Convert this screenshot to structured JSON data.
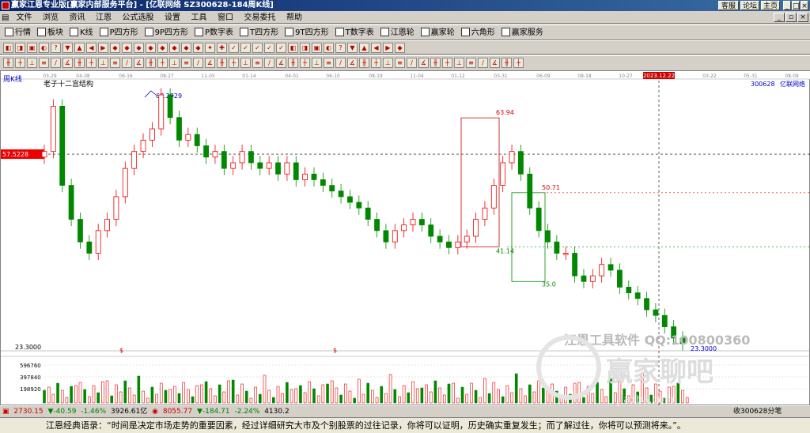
{
  "window": {
    "title": "赢家江恩专业版[赢家内部服务平台] - [亿联网络  SZ300628-184周K线]",
    "buttons": [
      "客服",
      "论坛",
      "主页"
    ]
  },
  "menu": [
    "文件",
    "浏览",
    "资讯",
    "江恩",
    "公式选股",
    "设置",
    "工具",
    "窗口",
    "交易委托",
    "帮助"
  ],
  "toolbar1": [
    {
      "label": "行情",
      "icon": "grid-icon"
    },
    {
      "label": "板块",
      "icon": "blocks-icon"
    },
    {
      "label": "K线",
      "icon": "candlestick-icon"
    },
    {
      "label": "P四方形",
      "icon": "square-p-icon"
    },
    {
      "label": "9P四方形",
      "icon": "square-9p-icon"
    },
    {
      "label": "P数字表",
      "icon": "table-p-icon"
    },
    {
      "label": "T四方形",
      "icon": "square-t-icon"
    },
    {
      "label": "9T四方形",
      "icon": "square-9t-icon"
    },
    {
      "label": "T数字表",
      "icon": "table-t-icon"
    },
    {
      "label": "江恩轮",
      "icon": "wheel-icon"
    },
    {
      "label": "赢家轮",
      "icon": "wheel2-icon"
    },
    {
      "label": "六角形",
      "icon": "hexagon-icon"
    },
    {
      "label": "赢家服务",
      "icon": "service-icon"
    }
  ],
  "chart": {
    "period_label": "周K线",
    "title": "老子十二宫结构",
    "code": "300628",
    "name": "亿联网络",
    "high_label": "68.2929",
    "price_marker": "57.5228",
    "low_label": "23.3000",
    "low_label_right": "23.3000",
    "annotations": [
      "63.94",
      "41.14",
      "50.71",
      "35.0"
    ],
    "crosshair_date": "2023.12.22",
    "date_labels": [
      "03-29",
      "04-08",
      "06-16",
      "08-27",
      "11-05",
      "01-14",
      "04-01",
      "06-10",
      "08-19",
      "11-04",
      "01-12",
      "03-31",
      "06-09",
      "08-18",
      "10-27",
      "03-22",
      "05-31",
      "08-09"
    ],
    "volume_labels": [
      "596760",
      "397840",
      "198920"
    ],
    "dollar_marks": [
      "$",
      "$",
      "$"
    ],
    "watermark_1": "江恩工具软件  QQ:100800360",
    "watermark_2": "赢家聊吧",
    "watermark_3": "jiaoba.com"
  },
  "chart_data": {
    "type": "candlestick",
    "title": "老子十二宫结构",
    "ylim": [
      23.3,
      68.2929
    ],
    "volume_ticks": [
      198920,
      397840,
      596760
    ],
    "closes": [
      58,
      66,
      52,
      46,
      42,
      40,
      44,
      46,
      50,
      55,
      58,
      60,
      62,
      68,
      64,
      60,
      61,
      59,
      57,
      58,
      55,
      56,
      58,
      56,
      55,
      56,
      54,
      56,
      53,
      54,
      53,
      52,
      51,
      50,
      49,
      48,
      46,
      44,
      42,
      44,
      45,
      46,
      45,
      43,
      42,
      41,
      42,
      43,
      46,
      48,
      52,
      56,
      58,
      54,
      48,
      44,
      42,
      40,
      40,
      36,
      35,
      36,
      38,
      37,
      34,
      33,
      32,
      30,
      29,
      27,
      25,
      24
    ]
  },
  "statusbar": {
    "items": [
      {
        "text": "2730.15",
        "cls": "up"
      },
      {
        "text": "▼-40.59",
        "cls": "dn"
      },
      {
        "text": "-1.46%",
        "cls": "dn"
      },
      {
        "text": "3926.61亿",
        "cls": ""
      },
      {
        "text": "8055.77",
        "cls": "up"
      },
      {
        "text": "▼-184.71",
        "cls": "dn"
      },
      {
        "text": "-2.24%",
        "cls": "dn"
      },
      {
        "text": "4130.2",
        "cls": ""
      }
    ],
    "right_text": "收300628分笔"
  },
  "quote": "江恩经典语录：“时间是决定市场走势的重要因素，经过详细研究大市及个别股票的过往记录，你将可以证明，历史确实重复发生；而了解过往，你将可以预测将来。”。"
}
